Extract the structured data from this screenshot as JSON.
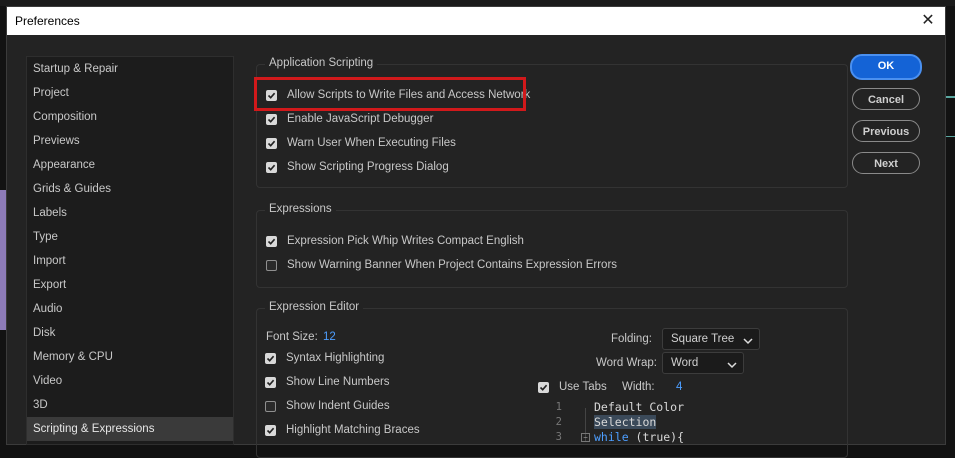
{
  "dialog": {
    "title": "Preferences"
  },
  "sidebar": {
    "items": [
      {
        "label": "Startup & Repair",
        "selected": false
      },
      {
        "label": "Project",
        "selected": false
      },
      {
        "label": "Composition",
        "selected": false
      },
      {
        "label": "Previews",
        "selected": false
      },
      {
        "label": "Appearance",
        "selected": false
      },
      {
        "label": "Grids & Guides",
        "selected": false
      },
      {
        "label": "Labels",
        "selected": false
      },
      {
        "label": "Type",
        "selected": false
      },
      {
        "label": "Import",
        "selected": false
      },
      {
        "label": "Export",
        "selected": false
      },
      {
        "label": "Audio",
        "selected": false
      },
      {
        "label": "Disk",
        "selected": false
      },
      {
        "label": "Memory & CPU",
        "selected": false
      },
      {
        "label": "Video",
        "selected": false
      },
      {
        "label": "3D",
        "selected": false
      },
      {
        "label": "Scripting & Expressions",
        "selected": true
      }
    ]
  },
  "buttons": {
    "ok": "OK",
    "cancel": "Cancel",
    "previous": "Previous",
    "next": "Next"
  },
  "application_scripting": {
    "title": "Application Scripting",
    "options": [
      {
        "label": "Allow Scripts to Write Files and Access Network",
        "checked": true
      },
      {
        "label": "Enable JavaScript Debugger",
        "checked": true
      },
      {
        "label": "Warn User When Executing Files",
        "checked": true
      },
      {
        "label": "Show Scripting Progress Dialog",
        "checked": true
      }
    ]
  },
  "expressions": {
    "title": "Expressions",
    "options": [
      {
        "label": "Expression Pick Whip Writes Compact English",
        "checked": true
      },
      {
        "label": "Show Warning Banner When Project Contains Expression Errors",
        "checked": false
      }
    ]
  },
  "expression_editor": {
    "title": "Expression Editor",
    "font_size_label": "Font Size:",
    "font_size_value": "12",
    "folding_label": "Folding:",
    "folding_value": "Square Tree",
    "word_wrap_label": "Word Wrap:",
    "word_wrap_value": "Word",
    "use_tabs_label": "Use Tabs",
    "use_tabs_checked": true,
    "width_label": "Width:",
    "width_value": "4",
    "options": [
      {
        "label": "Syntax Highlighting",
        "checked": true
      },
      {
        "label": "Show Line Numbers",
        "checked": true
      },
      {
        "label": "Show Indent Guides",
        "checked": false
      },
      {
        "label": "Highlight Matching Braces",
        "checked": true
      }
    ],
    "preview_lines": [
      {
        "num": "1",
        "text": "Default Color"
      },
      {
        "num": "2",
        "text": "Selection"
      },
      {
        "num": "3",
        "keyword": "while",
        "rest": " (true){"
      }
    ]
  },
  "colors": {
    "accent": "#1463d6",
    "highlight_red": "#d1191b",
    "value_blue": "#4d9eff"
  }
}
